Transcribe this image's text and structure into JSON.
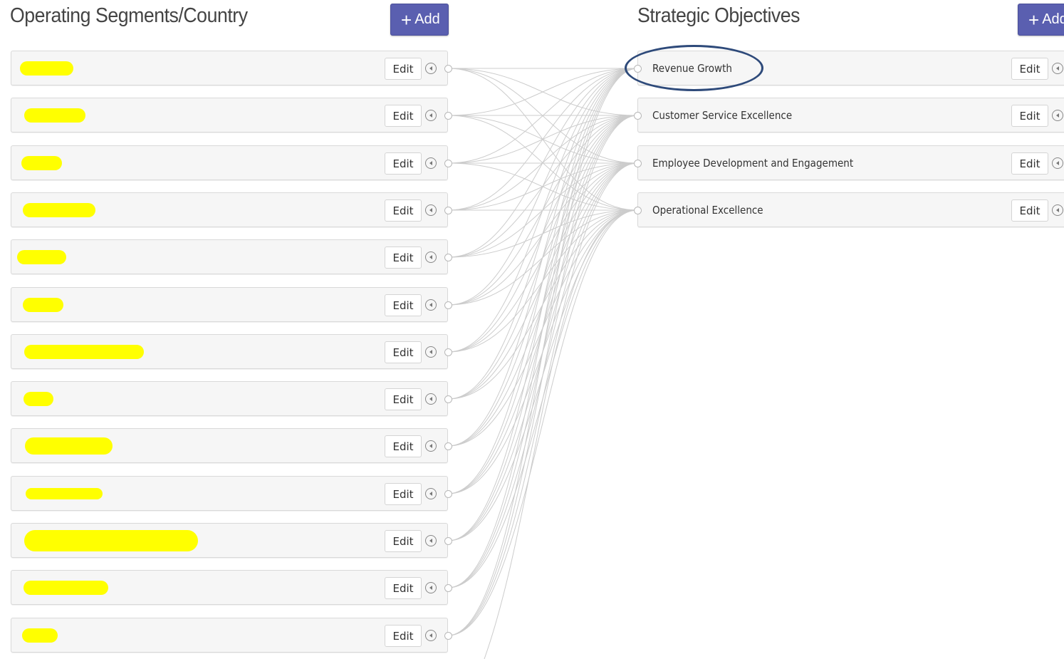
{
  "left_column": {
    "title": "Operating Segments/Country",
    "add_label": "Add",
    "items": [
      {
        "edit_label": "Edit"
      },
      {
        "edit_label": "Edit"
      },
      {
        "edit_label": "Edit"
      },
      {
        "edit_label": "Edit"
      },
      {
        "edit_label": "Edit"
      },
      {
        "edit_label": "Edit"
      },
      {
        "edit_label": "Edit"
      },
      {
        "edit_label": "Edit"
      },
      {
        "edit_label": "Edit"
      },
      {
        "edit_label": "Edit"
      },
      {
        "edit_label": "Edit"
      },
      {
        "edit_label": "Edit"
      },
      {
        "edit_label": "Edit"
      }
    ]
  },
  "right_column": {
    "title": "Strategic Objectives",
    "add_label": "Add",
    "items": [
      {
        "label": "Revenue Growth",
        "edit_label": "Edit"
      },
      {
        "label": "Customer Service Excellence",
        "edit_label": "Edit"
      },
      {
        "label": "Employee Development and Engagement",
        "edit_label": "Edit"
      },
      {
        "label": "Operational Excellence",
        "edit_label": "Edit"
      }
    ]
  },
  "colors": {
    "accent_button": "#5a5fb0",
    "redaction_highlight": "#ffff00",
    "annotation_ellipse": "#2e4a7a",
    "connector_line": "#cccccc"
  }
}
